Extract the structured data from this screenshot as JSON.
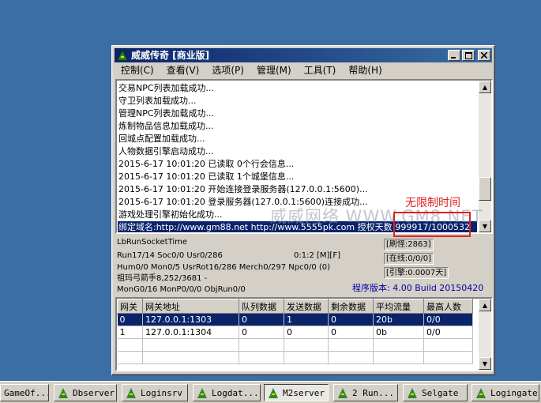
{
  "window": {
    "title": "威威传奇 [商业版]",
    "menu": [
      "控制(C)",
      "查看(V)",
      "选项(P)",
      "管理(M)",
      "工具(T)",
      "帮助(H)"
    ]
  },
  "log": [
    "交易NPC列表加载成功...",
    "守卫列表加载成功...",
    "管理NPC列表加载成功...",
    "炼制物品信息加载成功...",
    "回城点配置加载成功...",
    "人物数据引擎启动成功...",
    "2015-6-17 10:01:20 已读取 0个行会信息...",
    "2015-6-17 10:01:20 已读取 1个城堡信息...",
    "2015-6-17 10:01:20 开始连接登录服务器(127.0.0.1:5600)...",
    "2015-6-17 10:01:20 登录服务器(127.0.0.1:5600)连接成功...",
    "游戏处理引擎初始化成功...",
    "绑定域名:http://www.gm88.net http://www.5555pk.com 授权天数:999917/1000532"
  ],
  "status": {
    "socket": "LbRunSocketTime",
    "run": "Run17/14 Soc0/0 Usr0/286",
    "clock": "0:1:2 [M][F]",
    "hum": "Hum0/0 Mon0/5 UsrRot16/286 Merch0/297 Npc0/0 (0)",
    "monster": "祖玛弓箭手8,252/3681 -",
    "mong": "MonG0/16 MonP0/0/0 ObjRun0/0",
    "refresh": "[刷怪:2863]",
    "online": "[在线:0/0/0]",
    "engine": "[引擎:0.0007天]",
    "version": "程序版本: 4.00 Build 20150420"
  },
  "grid": {
    "headers": [
      "网关",
      "网关地址",
      "队列数据",
      "发送数据",
      "剩余数据",
      "平均流量",
      "最高人数"
    ],
    "rows": [
      [
        "0",
        "127.0.0.1:1303",
        "0",
        "1",
        "0",
        "20b",
        "0/0"
      ],
      [
        "1",
        "127.0.0.1:1304",
        "0",
        "0",
        "0",
        "0b",
        "0/0"
      ]
    ]
  },
  "overlay": {
    "unlimited": "无限制时间",
    "watermark": "威威网络 WWW.GM8.NET"
  },
  "taskbar": [
    "GameOf...",
    "Dbserver",
    "Loginsrv",
    "Logdat...",
    "M2server",
    "2 Run...",
    "Selgate",
    "Logingate"
  ],
  "colors": {
    "desktop": "#3a6ea5",
    "titlebar": "#0a246a",
    "highlight": "#0a246a",
    "red": "#e02020"
  }
}
